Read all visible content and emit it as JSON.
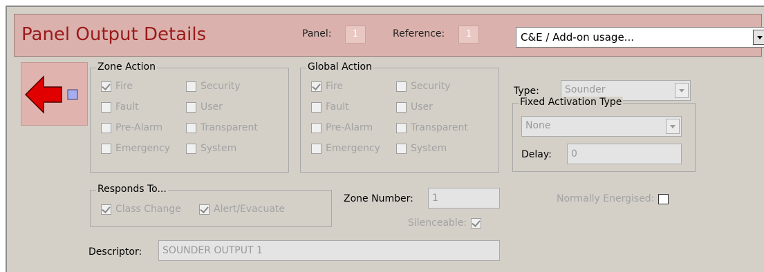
{
  "header": {
    "title": "Panel Output Details",
    "panel_label": "Panel:",
    "panel_value": "1",
    "reference_label": "Reference:",
    "reference_value": "1",
    "usage_select": "C&E / Add-on usage..."
  },
  "zone_action": {
    "title": "Zone Action",
    "options": [
      {
        "label": "Fire",
        "checked": true
      },
      {
        "label": "Security",
        "checked": false
      },
      {
        "label": "Fault",
        "checked": false
      },
      {
        "label": "User",
        "checked": false
      },
      {
        "label": "Pre-Alarm",
        "checked": false
      },
      {
        "label": "Transparent",
        "checked": false
      },
      {
        "label": "Emergency",
        "checked": false
      },
      {
        "label": "System",
        "checked": false
      }
    ]
  },
  "global_action": {
    "title": "Global Action",
    "options": [
      {
        "label": "Fire",
        "checked": true
      },
      {
        "label": "Security",
        "checked": false
      },
      {
        "label": "Fault",
        "checked": false
      },
      {
        "label": "User",
        "checked": false
      },
      {
        "label": "Pre-Alarm",
        "checked": false
      },
      {
        "label": "Transparent",
        "checked": false
      },
      {
        "label": "Emergency",
        "checked": false
      },
      {
        "label": "System",
        "checked": false
      }
    ]
  },
  "type": {
    "label": "Type:",
    "value": "Sounder"
  },
  "fixed_activation": {
    "title": "Fixed Activation Type",
    "value": "None",
    "delay_label": "Delay:",
    "delay_value": "0"
  },
  "responds_to": {
    "title": "Responds To...",
    "options": [
      {
        "label": "Class Change",
        "checked": true
      },
      {
        "label": "Alert/Evacuate",
        "checked": true
      }
    ]
  },
  "zone_number": {
    "label": "Zone Number:",
    "value": "1"
  },
  "silenceable": {
    "label": "Silenceable:",
    "checked": true
  },
  "normally_energised": {
    "label": "Normally Energised:",
    "checked": false
  },
  "descriptor": {
    "label": "Descriptor:",
    "value": "SOUNDER OUTPUT 1"
  },
  "colors": {
    "title_red": "#9b1b1b",
    "header_bg": "#dab1ac",
    "arrow_red": "#e00000",
    "square_blue": "#a6aef0"
  }
}
